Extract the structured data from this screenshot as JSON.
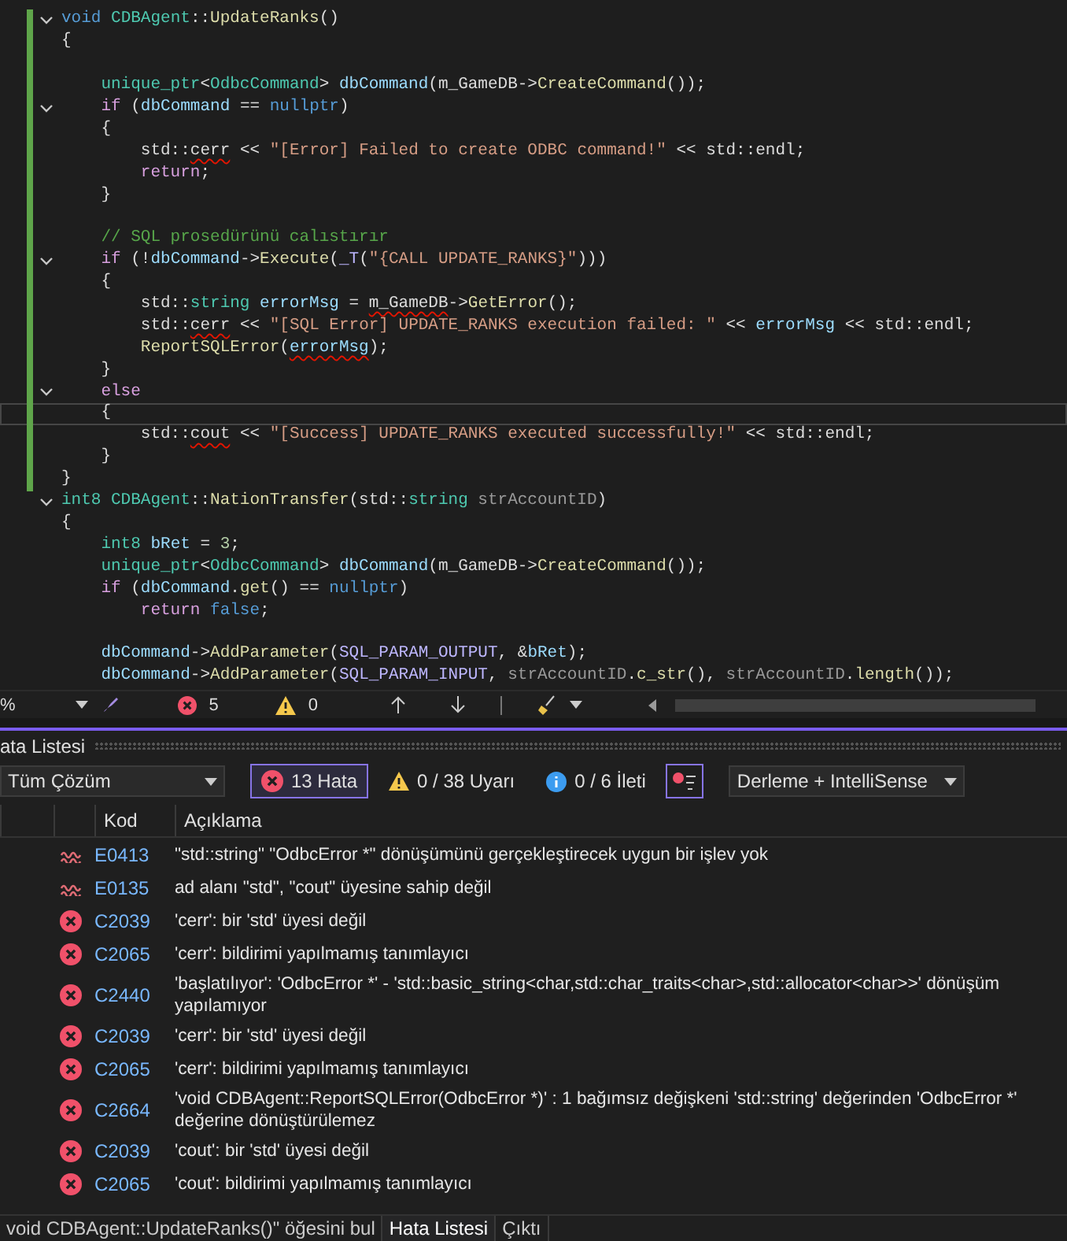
{
  "editor": {
    "lines": [
      {
        "modified": true,
        "fold": true,
        "current": false,
        "segments": [
          {
            "text": "void ",
            "color": "#569cd6",
            "squiggly": false
          },
          {
            "text": "CDBAgent",
            "color": "#4ec9b0",
            "squiggly": false
          },
          {
            "text": "::",
            "color": "#dcdcdc",
            "squiggly": false
          },
          {
            "text": "UpdateRanks",
            "color": "#dcdcaa",
            "squiggly": false
          },
          {
            "text": "()",
            "color": "#dcdcdc",
            "squiggly": false
          }
        ]
      },
      {
        "modified": true,
        "fold": false,
        "current": false,
        "segments": [
          {
            "text": "{",
            "color": "#dcdcdc",
            "squiggly": false
          }
        ]
      },
      {
        "modified": true,
        "fold": false,
        "current": false
      },
      {
        "modified": true,
        "fold": false,
        "current": false,
        "segments": [
          {
            "text": "    unique_ptr",
            "color": "#4ec9b0",
            "squiggly": false
          },
          {
            "text": "<",
            "color": "#dcdcdc",
            "squiggly": false
          },
          {
            "text": "OdbcCommand",
            "color": "#4ec9b0",
            "squiggly": false
          },
          {
            "text": "> ",
            "color": "#dcdcdc",
            "squiggly": false
          },
          {
            "text": "dbCommand",
            "color": "#9cdcfe",
            "squiggly": false
          },
          {
            "text": "(m_GameDB->",
            "color": "#dcdcdc",
            "squiggly": false
          },
          {
            "text": "CreateCommand",
            "color": "#dcdcaa",
            "squiggly": false
          },
          {
            "text": "());",
            "color": "#dcdcdc",
            "squiggly": false
          }
        ]
      },
      {
        "modified": true,
        "fold": true,
        "current": false,
        "segments": [
          {
            "text": "    if",
            "color": "#d8a0df",
            "squiggly": false
          },
          {
            "text": " (",
            "color": "#dcdcdc",
            "squiggly": false
          },
          {
            "text": "dbCommand",
            "color": "#9cdcfe",
            "squiggly": false
          },
          {
            "text": " == ",
            "color": "#dcdcdc",
            "squiggly": false
          },
          {
            "text": "nullptr",
            "color": "#569cd6",
            "squiggly": false
          },
          {
            "text": ")",
            "color": "#dcdcdc",
            "squiggly": false
          }
        ]
      },
      {
        "modified": true,
        "fold": false,
        "current": false,
        "segments": [
          {
            "text": "    {",
            "color": "#dcdcdc",
            "squiggly": false
          }
        ]
      },
      {
        "modified": true,
        "fold": false,
        "current": false,
        "segments": [
          {
            "text": "        std::",
            "color": "#dcdcdc",
            "squiggly": false
          },
          {
            "text": "cerr",
            "color": "#dcdcdc",
            "squiggly": true
          },
          {
            "text": " << ",
            "color": "#dcdcdc",
            "squiggly": false
          },
          {
            "text": "\"[Error] Failed to create ODBC command!\"",
            "color": "#d69d85",
            "squiggly": false
          },
          {
            "text": " << std::endl;",
            "color": "#dcdcdc",
            "squiggly": false
          }
        ]
      },
      {
        "modified": true,
        "fold": false,
        "current": false,
        "segments": [
          {
            "text": "        return",
            "color": "#d8a0df",
            "squiggly": false
          },
          {
            "text": ";",
            "color": "#dcdcdc",
            "squiggly": false
          }
        ]
      },
      {
        "modified": true,
        "fold": false,
        "current": false,
        "segments": [
          {
            "text": "    }",
            "color": "#dcdcdc",
            "squiggly": false
          }
        ]
      },
      {
        "modified": true,
        "fold": false,
        "current": false
      },
      {
        "modified": true,
        "fold": false,
        "current": false,
        "segments": [
          {
            "text": "    // SQL prosedürünü calıstırır",
            "color": "#57a64a",
            "squiggly": false
          }
        ]
      },
      {
        "modified": true,
        "fold": true,
        "current": false,
        "segments": [
          {
            "text": "    if",
            "color": "#d8a0df",
            "squiggly": false
          },
          {
            "text": " (!",
            "color": "#dcdcdc",
            "squiggly": false
          },
          {
            "text": "dbCommand",
            "color": "#9cdcfe",
            "squiggly": false
          },
          {
            "text": "->",
            "color": "#dcdcdc",
            "squiggly": false
          },
          {
            "text": "Execute",
            "color": "#dcdcaa",
            "squiggly": false
          },
          {
            "text": "(",
            "color": "#dcdcdc",
            "squiggly": false
          },
          {
            "text": "_T",
            "color": "#beb7ff",
            "squiggly": false
          },
          {
            "text": "(",
            "color": "#dcdcdc",
            "squiggly": false
          },
          {
            "text": "\"{CALL UPDATE_RANKS}\"",
            "color": "#d69d85",
            "squiggly": false
          },
          {
            "text": ")))",
            "color": "#dcdcdc",
            "squiggly": false
          }
        ]
      },
      {
        "modified": true,
        "fold": false,
        "current": false,
        "segments": [
          {
            "text": "    {",
            "color": "#dcdcdc",
            "squiggly": false
          }
        ]
      },
      {
        "modified": true,
        "fold": false,
        "current": false,
        "segments": [
          {
            "text": "        std::",
            "color": "#dcdcdc",
            "squiggly": false
          },
          {
            "text": "string ",
            "color": "#4ec9b0",
            "squiggly": false
          },
          {
            "text": "errorMsg",
            "color": "#9cdcfe",
            "squiggly": false
          },
          {
            "text": " = ",
            "color": "#dcdcdc",
            "squiggly": false
          },
          {
            "text": "m_GameDB",
            "color": "#dcdcdc",
            "squiggly": true
          },
          {
            "text": "->",
            "color": "#dcdcdc",
            "squiggly": false
          },
          {
            "text": "GetError",
            "color": "#dcdcaa",
            "squiggly": false
          },
          {
            "text": "();",
            "color": "#dcdcdc",
            "squiggly": false
          }
        ]
      },
      {
        "modified": true,
        "fold": false,
        "current": false,
        "segments": [
          {
            "text": "        std::",
            "color": "#dcdcdc",
            "squiggly": false
          },
          {
            "text": "cerr",
            "color": "#dcdcdc",
            "squiggly": true
          },
          {
            "text": " << ",
            "color": "#dcdcdc",
            "squiggly": false
          },
          {
            "text": "\"[SQL Error] UPDATE_RANKS execution failed: \"",
            "color": "#d69d85",
            "squiggly": false
          },
          {
            "text": " << ",
            "color": "#dcdcdc",
            "squiggly": false
          },
          {
            "text": "errorMsg",
            "color": "#9cdcfe",
            "squiggly": false
          },
          {
            "text": " << std::endl;",
            "color": "#dcdcdc",
            "squiggly": false
          }
        ]
      },
      {
        "modified": true,
        "fold": false,
        "current": false,
        "segments": [
          {
            "text": "        ReportSQLError",
            "color": "#dcdcaa",
            "squiggly": false
          },
          {
            "text": "(",
            "color": "#dcdcdc",
            "squiggly": false
          },
          {
            "text": "errorMsg",
            "color": "#9cdcfe",
            "squiggly": true
          },
          {
            "text": ");",
            "color": "#dcdcdc",
            "squiggly": false
          }
        ]
      },
      {
        "modified": true,
        "fold": false,
        "current": false,
        "segments": [
          {
            "text": "    }",
            "color": "#dcdcdc",
            "squiggly": false
          }
        ]
      },
      {
        "modified": true,
        "fold": true,
        "current": false,
        "segments": [
          {
            "text": "    else",
            "color": "#d8a0df",
            "squiggly": false
          }
        ]
      },
      {
        "modified": true,
        "fold": false,
        "current": true,
        "segments": [
          {
            "text": "    {",
            "color": "#dcdcdc",
            "squiggly": false
          }
        ]
      },
      {
        "modified": true,
        "fold": false,
        "current": false,
        "segments": [
          {
            "text": "        std::",
            "color": "#dcdcdc",
            "squiggly": false
          },
          {
            "text": "cout",
            "color": "#dcdcdc",
            "squiggly": true
          },
          {
            "text": " << ",
            "color": "#dcdcdc",
            "squiggly": false
          },
          {
            "text": "\"[Success] UPDATE_RANKS executed successfully!\"",
            "color": "#d69d85",
            "squiggly": false
          },
          {
            "text": " << std::endl;",
            "color": "#dcdcdc",
            "squiggly": false
          }
        ]
      },
      {
        "modified": true,
        "fold": false,
        "current": false,
        "segments": [
          {
            "text": "    }",
            "color": "#dcdcdc",
            "squiggly": false
          }
        ]
      },
      {
        "modified": true,
        "fold": false,
        "current": false,
        "segments": [
          {
            "text": "}",
            "color": "#dcdcdc",
            "squiggly": false
          }
        ]
      },
      {
        "modified": false,
        "fold": true,
        "current": false,
        "segments": [
          {
            "text": "int8 CDBAgent",
            "color": "#4ec9b0",
            "squiggly": false
          },
          {
            "text": "::",
            "color": "#dcdcdc",
            "squiggly": false
          },
          {
            "text": "NationTransfer",
            "color": "#dcdcaa",
            "squiggly": false
          },
          {
            "text": "(std::",
            "color": "#dcdcdc",
            "squiggly": false
          },
          {
            "text": "string ",
            "color": "#4ec9b0",
            "squiggly": false
          },
          {
            "text": "strAccountID",
            "color": "#9a9a9a",
            "squiggly": false
          },
          {
            "text": ")",
            "color": "#dcdcdc",
            "squiggly": false
          }
        ]
      },
      {
        "modified": false,
        "fold": false,
        "current": false,
        "segments": [
          {
            "text": "{",
            "color": "#dcdcdc",
            "squiggly": false
          }
        ]
      },
      {
        "modified": false,
        "fold": false,
        "current": false,
        "segments": [
          {
            "text": "    int8 ",
            "color": "#4ec9b0",
            "squiggly": false
          },
          {
            "text": "bRet",
            "color": "#9cdcfe",
            "squiggly": false
          },
          {
            "text": " = ",
            "color": "#dcdcdc",
            "squiggly": false
          },
          {
            "text": "3",
            "color": "#b5cea8",
            "squiggly": false
          },
          {
            "text": ";",
            "color": "#dcdcdc",
            "squiggly": false
          }
        ]
      },
      {
        "modified": false,
        "fold": false,
        "current": false,
        "segments": [
          {
            "text": "    unique_ptr",
            "color": "#4ec9b0",
            "squiggly": false
          },
          {
            "text": "<",
            "color": "#dcdcdc",
            "squiggly": false
          },
          {
            "text": "OdbcCommand",
            "color": "#4ec9b0",
            "squiggly": false
          },
          {
            "text": "> ",
            "color": "#dcdcdc",
            "squiggly": false
          },
          {
            "text": "dbCommand",
            "color": "#9cdcfe",
            "squiggly": false
          },
          {
            "text": "(m_GameDB->",
            "color": "#dcdcdc",
            "squiggly": false
          },
          {
            "text": "CreateCommand",
            "color": "#dcdcaa",
            "squiggly": false
          },
          {
            "text": "());",
            "color": "#dcdcdc",
            "squiggly": false
          }
        ]
      },
      {
        "modified": false,
        "fold": false,
        "current": false,
        "segments": [
          {
            "text": "    if",
            "color": "#d8a0df",
            "squiggly": false
          },
          {
            "text": " (",
            "color": "#dcdcdc",
            "squiggly": false
          },
          {
            "text": "dbCommand",
            "color": "#9cdcfe",
            "squiggly": false
          },
          {
            "text": ".",
            "color": "#dcdcdc",
            "squiggly": false
          },
          {
            "text": "get",
            "color": "#dcdcaa",
            "squiggly": false
          },
          {
            "text": "() == ",
            "color": "#dcdcdc",
            "squiggly": false
          },
          {
            "text": "nullptr",
            "color": "#569cd6",
            "squiggly": false
          },
          {
            "text": ")",
            "color": "#dcdcdc",
            "squiggly": false
          }
        ]
      },
      {
        "modified": false,
        "fold": false,
        "current": false,
        "segments": [
          {
            "text": "        return ",
            "color": "#d8a0df",
            "squiggly": false
          },
          {
            "text": "false",
            "color": "#569cd6",
            "squiggly": false
          },
          {
            "text": ";",
            "color": "#dcdcdc",
            "squiggly": false
          }
        ]
      },
      {
        "modified": false,
        "fold": false,
        "current": false
      },
      {
        "modified": false,
        "fold": false,
        "current": false,
        "segments": [
          {
            "text": "    dbCommand",
            "color": "#9cdcfe",
            "squiggly": false
          },
          {
            "text": "->",
            "color": "#dcdcdc",
            "squiggly": false
          },
          {
            "text": "AddParameter",
            "color": "#dcdcaa",
            "squiggly": false
          },
          {
            "text": "(",
            "color": "#dcdcdc",
            "squiggly": false
          },
          {
            "text": "SQL_PARAM_OUTPUT",
            "color": "#beb7ff",
            "squiggly": false
          },
          {
            "text": ", &",
            "color": "#dcdcdc",
            "squiggly": false
          },
          {
            "text": "bRet",
            "color": "#9cdcfe",
            "squiggly": false
          },
          {
            "text": ");",
            "color": "#dcdcdc",
            "squiggly": false
          }
        ]
      },
      {
        "modified": false,
        "fold": false,
        "current": false,
        "segments": [
          {
            "text": "    dbCommand",
            "color": "#9cdcfe",
            "squiggly": false
          },
          {
            "text": "->",
            "color": "#dcdcdc",
            "squiggly": false
          },
          {
            "text": "AddParameter",
            "color": "#dcdcaa",
            "squiggly": false
          },
          {
            "text": "(",
            "color": "#dcdcdc",
            "squiggly": false
          },
          {
            "text": "SQL_PARAM_INPUT",
            "color": "#beb7ff",
            "squiggly": false
          },
          {
            "text": ", ",
            "color": "#dcdcdc",
            "squiggly": false
          },
          {
            "text": "strAccountID",
            "color": "#9a9a9a",
            "squiggly": false
          },
          {
            "text": ".",
            "color": "#dcdcdc",
            "squiggly": false
          },
          {
            "text": "c_str",
            "color": "#dcdcaa",
            "squiggly": false
          },
          {
            "text": "(), ",
            "color": "#dcdcdc",
            "squiggly": false
          },
          {
            "text": "strAccountID",
            "color": "#9a9a9a",
            "squiggly": false
          },
          {
            "text": ".",
            "color": "#dcdcdc",
            "squiggly": false
          },
          {
            "text": "length",
            "color": "#dcdcaa",
            "squiggly": false
          },
          {
            "text": "());",
            "color": "#dcdcdc",
            "squiggly": false
          }
        ]
      }
    ]
  },
  "editor_status": {
    "zoom": "%",
    "errors": "5",
    "warnings": "0"
  },
  "error_list": {
    "title": "ata Listesi",
    "scope": "Tüm Çözüm",
    "filters": [
      {
        "kind": "error",
        "label": "13 Hata",
        "selected": true
      },
      {
        "kind": "warning",
        "label": "0 / 38 Uyarı",
        "selected": false
      },
      {
        "kind": "info",
        "label": "0 / 6 İleti",
        "selected": false
      }
    ],
    "source": "Derleme + IntelliSense",
    "columns": [
      "Kod",
      "Açıklama"
    ],
    "rows": [
      {
        "kind": "intellisense",
        "code": "E0413",
        "lines": [
          "\"std::string\" \"OdbcError *\" dönüşümünü gerçekleştirecek uygun bir işlev yok"
        ]
      },
      {
        "kind": "intellisense",
        "code": "E0135",
        "lines": [
          "ad alanı \"std\", \"cout\" üyesine sahip değil"
        ]
      },
      {
        "kind": "error",
        "code": "C2039",
        "lines": [
          "'cerr': bir 'std' üyesi değil"
        ]
      },
      {
        "kind": "error",
        "code": "C2065",
        "lines": [
          "'cerr': bildirimi yapılmamış tanımlayıcı"
        ]
      },
      {
        "kind": "error",
        "code": "C2440",
        "lines": [
          "'başlatılıyor': 'OdbcError *' - 'std::basic_string<char,std::char_traits<char>,std::allocator<char>>' dönüşüm",
          "yapılamıyor"
        ]
      },
      {
        "kind": "error",
        "code": "C2039",
        "lines": [
          "'cerr': bir 'std' üyesi değil"
        ]
      },
      {
        "kind": "error",
        "code": "C2065",
        "lines": [
          "'cerr': bildirimi yapılmamış tanımlayıcı"
        ]
      },
      {
        "kind": "error",
        "code": "C2664",
        "lines": [
          "'void CDBAgent::ReportSQLError(OdbcError *)' : 1 bağımsız değişkeni 'std::string' değerinden 'OdbcError *'",
          "değerine dönüştürülemez"
        ]
      },
      {
        "kind": "error",
        "code": "C2039",
        "lines": [
          "'cout': bir 'std' üyesi değil"
        ]
      },
      {
        "kind": "error",
        "code": "C2065",
        "lines": [
          "'cout': bildirimi yapılmamış tanımlayıcı"
        ]
      }
    ]
  },
  "bottom_tabs": [
    {
      "label": "void CDBAgent::UpdateRanks()\" öğesini bul",
      "selected": false
    },
    {
      "label": "Hata Listesi",
      "selected": true
    },
    {
      "label": "Çıktı",
      "selected": false
    }
  ]
}
